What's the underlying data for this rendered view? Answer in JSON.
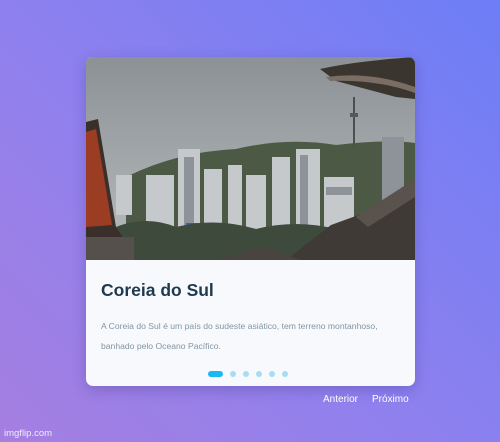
{
  "card": {
    "title": "Coreia do Sul",
    "description": "A Coreia do Sul é um país do sudeste asiático, tem terreno montanhoso, banhado pelo Oceano Pacífico."
  },
  "carousel": {
    "slide_count": 6,
    "active_index": 0
  },
  "nav": {
    "prev_label": "Anterior",
    "next_label": "Próximo"
  },
  "watermark": "imgflip.com",
  "colors": {
    "title": "#1f3a4c",
    "dot_active": "#1bb9ef",
    "dot_inactive": "#a8dcf2"
  }
}
